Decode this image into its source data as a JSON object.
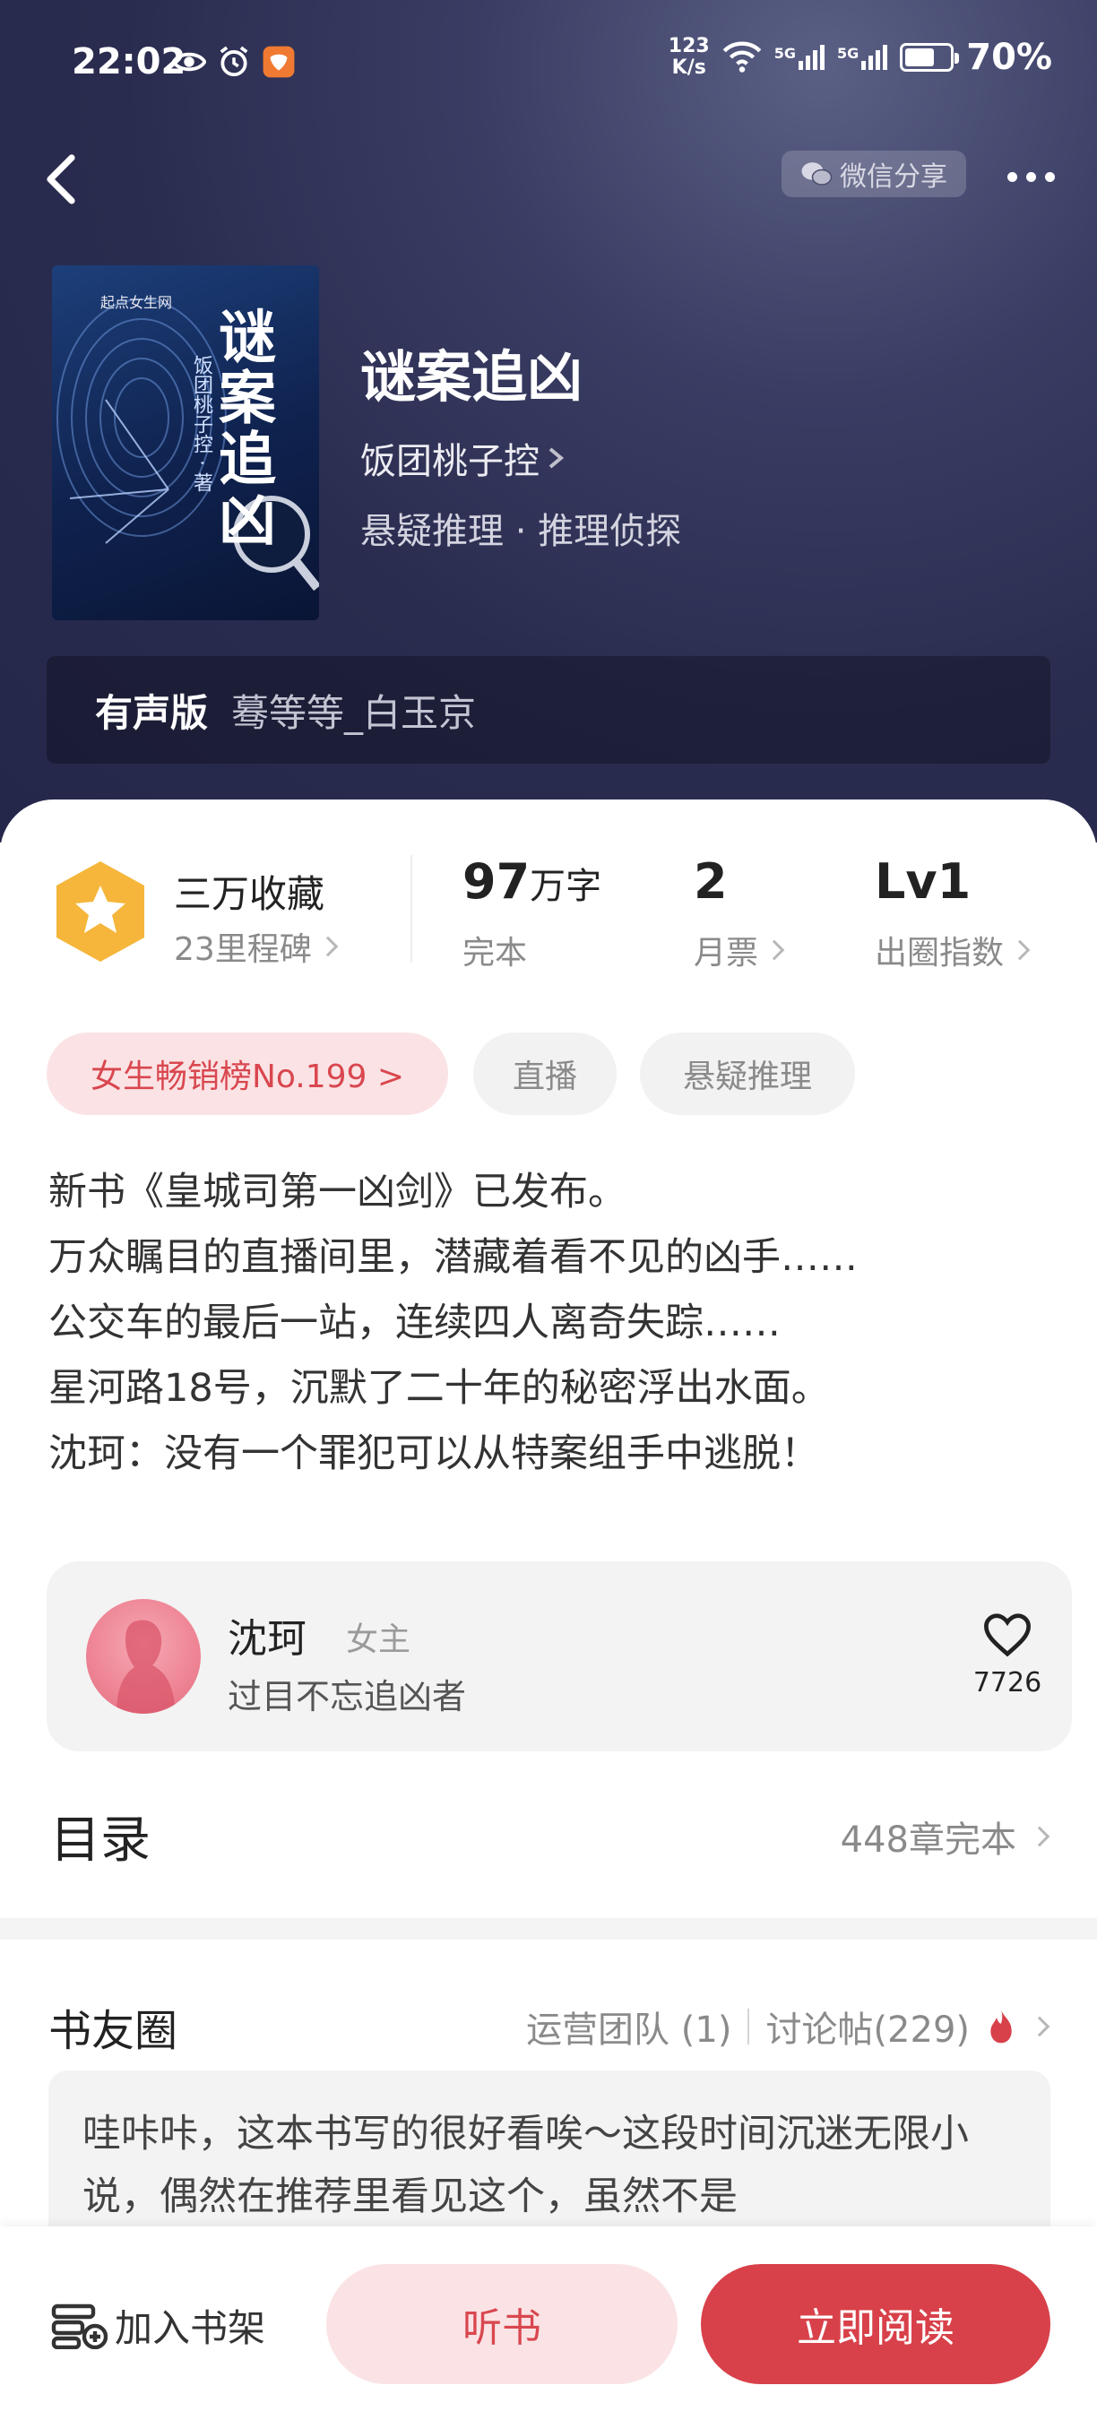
{
  "status_bar": {
    "time": "22:02",
    "speed_value": "123",
    "speed_unit": "K/s",
    "network_1": "5G",
    "network_2": "5G",
    "battery": "70%"
  },
  "nav": {
    "share_label": "微信分享"
  },
  "book": {
    "title": "谜案追凶",
    "author": "饭团桃子控",
    "genre": "悬疑推理 · 推理侦探"
  },
  "cover": {
    "title": "谜案追凶",
    "author": "饭团桃子控 · 著",
    "brand": "起点女生网"
  },
  "audio": {
    "label": "有声版",
    "narrator": "蓦等等_白玉京"
  },
  "stats": {
    "badge_label": "三万收藏",
    "milestone": "23里程碑",
    "word_count_num": "97",
    "word_count_unit": "万字",
    "word_count_status": "完本",
    "monthly_votes": "2",
    "monthly_votes_label": "月票",
    "level": "Lv1",
    "level_label": "出圈指数"
  },
  "tags": {
    "rank": "女生畅销榜No.199 >",
    "live": "直播",
    "genre": "悬疑推理"
  },
  "intro": [
    "新书《皇城司第一凶剑》已发布。",
    "万众瞩目的直播间里，潜藏着看不见的凶手……",
    "公交车的最后一站，连续四人离奇失踪……",
    "星河路18号，沉默了二十年的秘密浮出水面。",
    "沈珂：没有一个罪犯可以从特案组手中逃脱！"
  ],
  "character": {
    "name": "沈珂",
    "role": "女主",
    "description": "过目不忘追凶者",
    "likes": "7726"
  },
  "toc": {
    "title": "目录",
    "status": "448章完本"
  },
  "club": {
    "title": "书友圈",
    "team": "运营团队 (1)",
    "posts_count": "讨论帖(229)",
    "post_text": "哇咔咔，这本书写的很好看唉～这段时间沉迷无限小说，偶然在推荐里看见这个，虽然不是"
  },
  "bottom": {
    "shelf": "加入书架",
    "listen": "听书",
    "read": "立即阅读"
  },
  "colors": {
    "accent": "#d8414a",
    "accent_light": "#fbe3e5",
    "hero_bg": "#2a2c4f",
    "badge": "#f5b63b"
  }
}
